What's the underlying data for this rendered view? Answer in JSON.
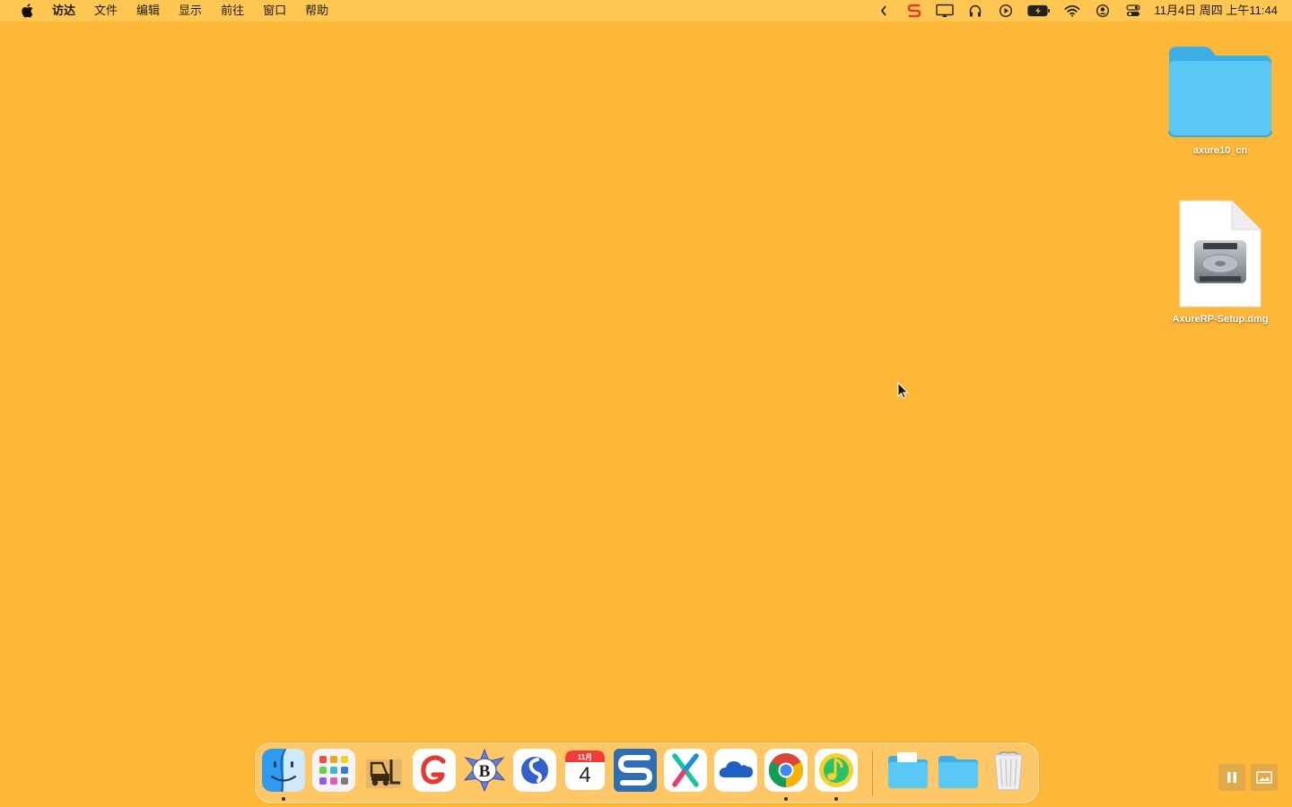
{
  "menubar": {
    "app_name": "访达",
    "menus": [
      "文件",
      "编辑",
      "显示",
      "前往",
      "窗口",
      "帮助"
    ],
    "clock": "11月4日 周四 上午11:44",
    "status_icons": [
      "chevron-left-icon",
      "s-app-icon",
      "display-icon",
      "headphones-icon",
      "play-icon",
      "battery-icon",
      "wifi-icon",
      "user-icon",
      "control-center-icon"
    ]
  },
  "desktop": {
    "items": [
      {
        "label": "axure10_cn",
        "kind": "folder"
      },
      {
        "label": "AxureRP-Setup.dmg",
        "kind": "disk-image"
      }
    ]
  },
  "dock": {
    "apps": [
      "finder",
      "launchpad",
      "forklift",
      "wps",
      "bbedit",
      "simplenote",
      "calendar",
      "scrivener",
      "axure",
      "onedrive",
      "chrome",
      "qq-music"
    ],
    "calendar": {
      "month": "11月",
      "day": "4"
    },
    "running": [
      "finder",
      "chrome",
      "qq-music"
    ],
    "trailing": [
      "documents-folder",
      "folder",
      "trash"
    ]
  },
  "colors": {
    "desktop": "#FEB737",
    "menubar": "#FFC752",
    "folder": "#5AC8F5"
  }
}
